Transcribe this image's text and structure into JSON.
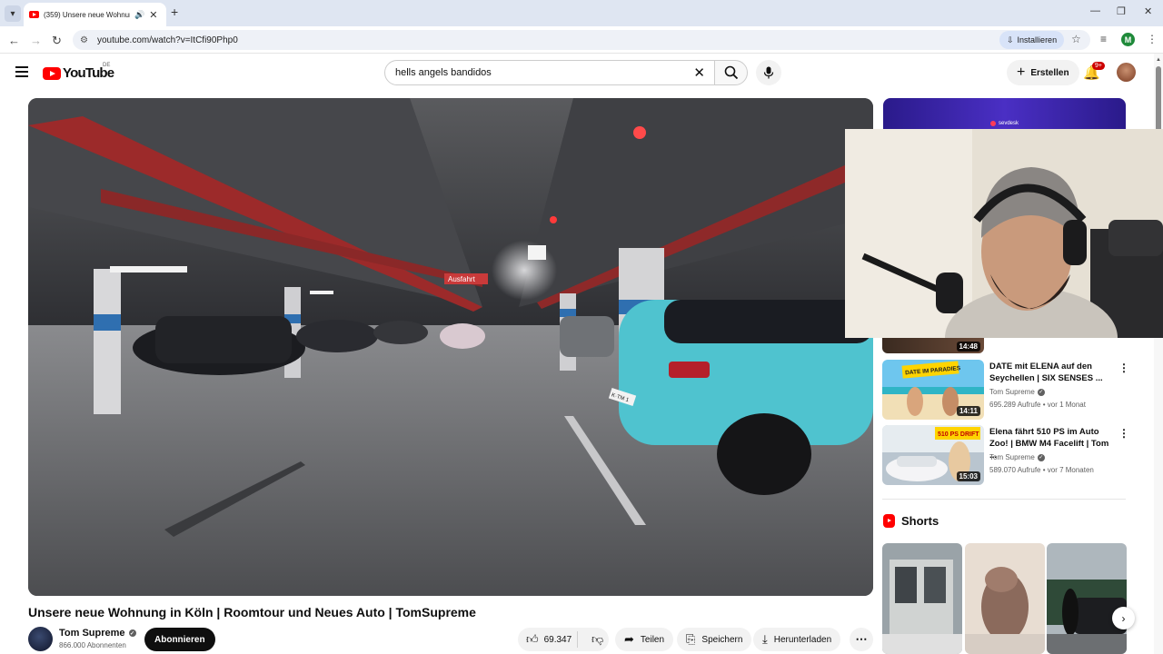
{
  "browser": {
    "tab_title": "(359) Unsere neue Wohnun",
    "url": "youtube.com/watch?v=ItCfi90Php0",
    "install_label": "Installieren",
    "profile_letter": "M",
    "new_tab": "+",
    "tab_close": "✕"
  },
  "header": {
    "logo_text": "YouTube",
    "country_code": "DE",
    "search_value": "hells angels bandidos",
    "create_label": "Erstellen",
    "notifications_badge": "9+"
  },
  "video": {
    "title": "Unsere neue Wohnung in Köln | Roomtour und Neues Auto | TomSupreme",
    "channel_name": "Tom Supreme",
    "subscribers": "866.000 Abonnenten",
    "subscribe_label": "Abonnieren",
    "likes": "69.347",
    "share_label": "Teilen",
    "save_label": "Speichern",
    "download_label": "Herunterladen",
    "scene_sign_text": "Ausfahrt",
    "car_plate": "K·TM 1"
  },
  "sidebar": {
    "ad_brand": "sevdesk",
    "partial_duration": "14:48",
    "recommendations": [
      {
        "title": "DATE mit ELENA auf den Seychellen | SIX SENSES ...",
        "channel": "Tom Supreme",
        "meta": "695.289 Aufrufe • vor 1 Monat",
        "duration": "14:11",
        "thumb_text": "DATE IM PARADIES"
      },
      {
        "title": "Elena fährt 510 PS im Auto Zoo! | BMW M4 Facelift | Tom ...",
        "channel": "Tom Supreme",
        "meta": "589.070 Aufrufe • vor 7 Monaten",
        "duration": "15:03",
        "thumb_text": "510 PS DRIFT"
      }
    ],
    "shorts_title": "Shorts"
  },
  "colors": {
    "brand_red": "#ff0000",
    "subscribe_bg": "#0f0f0f",
    "pill_bg": "#f2f2f2",
    "car_teal": "#4fc3cf"
  },
  "icons": {
    "back": "arrow-left-icon",
    "forward": "arrow-right-icon",
    "reload": "reload-icon",
    "search": "search-icon",
    "mic": "microphone-icon",
    "bell": "bell-icon",
    "like": "thumbs-up-icon",
    "dislike": "thumbs-down-icon",
    "share": "share-icon",
    "save": "bookmark-icon",
    "download": "download-icon"
  }
}
